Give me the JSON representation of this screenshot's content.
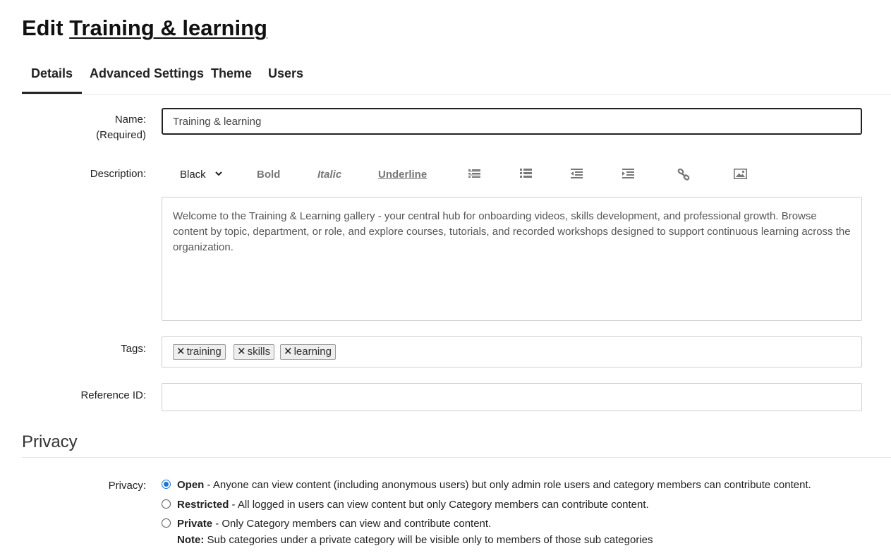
{
  "header": {
    "title_prefix": "Edit",
    "title_link": "Training & learning"
  },
  "tabs": [
    {
      "label": "Details",
      "active": true
    },
    {
      "label": "Advanced Settings",
      "active": false
    },
    {
      "label": "Theme",
      "active": false
    },
    {
      "label": "Users",
      "active": false
    }
  ],
  "form": {
    "name_label": "Name:",
    "name_required": "(Required)",
    "name_value": "Training & learning",
    "description_label": "Description:",
    "toolbar": {
      "color_value": "Black",
      "bold_label": "Bold",
      "italic_label": "Italic",
      "underline_label": "Underline",
      "icons": [
        "unordered-list-icon",
        "ordered-list-icon",
        "outdent-icon",
        "indent-icon",
        "link-icon",
        "image-icon"
      ]
    },
    "description_value": "Welcome to the Training & Learning gallery - your central hub for onboarding videos, skills development, and professional growth. Browse content by topic, department, or role, and explore courses, tutorials, and recorded workshops designed to support continuous learning across the organization.",
    "tags_label": "Tags:",
    "tags": [
      "training",
      "skills",
      "learning"
    ],
    "tag_remove_symbol": "✕",
    "reference_label": "Reference ID:",
    "reference_value": ""
  },
  "privacy": {
    "section_title": "Privacy",
    "label": "Privacy:",
    "options": [
      {
        "name": "Open",
        "description": " - Anyone can view content (including anonymous users) but only admin role users and category members can contribute content.",
        "checked": true
      },
      {
        "name": "Restricted",
        "description": " - All logged in users can view content but only Category members can contribute content.",
        "checked": false
      },
      {
        "name": "Private",
        "description": " - Only Category members can view and contribute content.",
        "checked": false
      }
    ],
    "note_label": "Note:",
    "note_text": " Sub categories under a private category will be visible only to members of those sub categories"
  },
  "colors": {
    "accent": "#1a73d9",
    "text": "#222222",
    "border": "#cfcfcf"
  }
}
